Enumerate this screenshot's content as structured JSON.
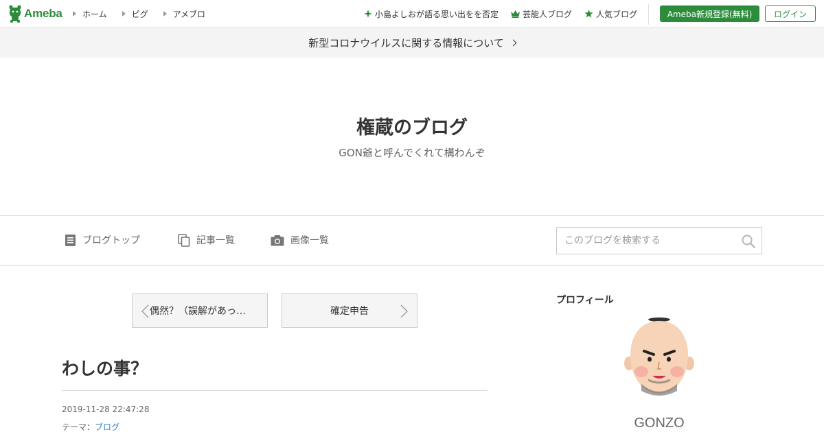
{
  "header": {
    "logo_text": "Ameba",
    "nav_left": [
      "ホーム",
      "ピグ",
      "アメブロ"
    ],
    "nav_right": [
      {
        "label": "小島よしおが語る思い出をを否定",
        "icon": "sparkle-icon"
      },
      {
        "label": "芸能人ブログ",
        "icon": "crown-icon"
      },
      {
        "label": "人気ブログ",
        "icon": "star-icon"
      }
    ],
    "register_label": "Ameba新規登録(無料)",
    "login_label": "ログイン"
  },
  "notice": {
    "text": "新型コロナウイルスに関する情報について"
  },
  "blog": {
    "title": "権蔵のブログ",
    "description": "GON爺と呼んでくれて構わんぞ"
  },
  "blognav": {
    "items": [
      {
        "label": "ブログトップ",
        "icon": "document-icon"
      },
      {
        "label": "記事一覧",
        "icon": "copy-icon"
      },
      {
        "label": "画像一覧",
        "icon": "camera-icon"
      }
    ],
    "search_placeholder": "このブログを検索する"
  },
  "pager": {
    "prev_label": "偶然？（誤解があっ…",
    "next_label": "確定申告"
  },
  "entry": {
    "title": "わしの事？",
    "datetime": "2019-11-28 22:47:28",
    "theme_prefix": "テーマ：",
    "theme_link": "ブログ"
  },
  "sidebar": {
    "profile_heading": "プロフィール",
    "profile_name": "GONZO"
  },
  "colors": {
    "brand_green": "#2d8c3c",
    "link_blue": "#3b7fc4"
  }
}
